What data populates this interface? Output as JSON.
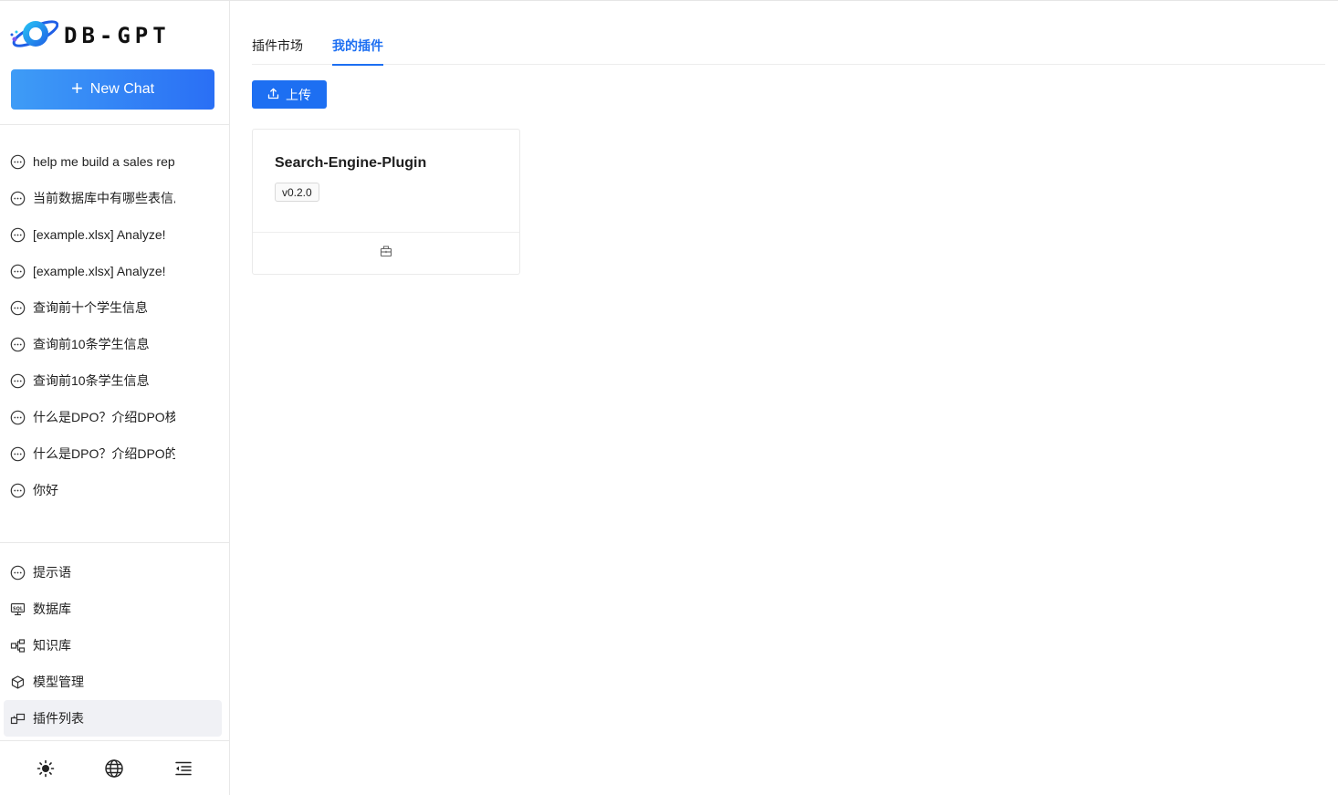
{
  "app": {
    "logo_text": "DB-GPT",
    "new_chat_label": "New Chat"
  },
  "chats": [
    {
      "label": "help me build a sales report"
    },
    {
      "label": "当前数据库中有哪些表信息"
    },
    {
      "label": "[example.xlsx] Analyze!"
    },
    {
      "label": "[example.xlsx] Analyze!"
    },
    {
      "label": "查询前十个学生信息"
    },
    {
      "label": "查询前10条学生信息"
    },
    {
      "label": "查询前10条学生信息"
    },
    {
      "label": "什么是DPO？介绍DPO核心"
    },
    {
      "label": "什么是DPO？介绍DPO的"
    },
    {
      "label": "你好"
    }
  ],
  "menu": [
    {
      "label": "提示语",
      "icon": "message-icon"
    },
    {
      "label": "数据库",
      "icon": "database-sql-icon"
    },
    {
      "label": "知识库",
      "icon": "knowledge-graph-icon"
    },
    {
      "label": "模型管理",
      "icon": "model-cube-icon"
    },
    {
      "label": "插件列表",
      "icon": "plugin-icon",
      "active": true
    }
  ],
  "bottom": {
    "theme_icon": "sun-icon",
    "language_icon": "globe-icon",
    "collapse_icon": "collapse-menu-icon"
  },
  "tabs": [
    {
      "label": "插件市场",
      "active": false
    },
    {
      "label": "我的插件",
      "active": true
    }
  ],
  "upload_label": "上传",
  "plugins": [
    {
      "name": "Search-Engine-Plugin",
      "version": "v0.2.0",
      "action_icon": "uninstall-icon"
    }
  ],
  "colors": {
    "accent": "#1d6ff2",
    "new_chat_gradient_start": "#3e9cf6",
    "new_chat_gradient_end": "#2a6ff5",
    "active_menu_bg": "#f0f1f5"
  }
}
